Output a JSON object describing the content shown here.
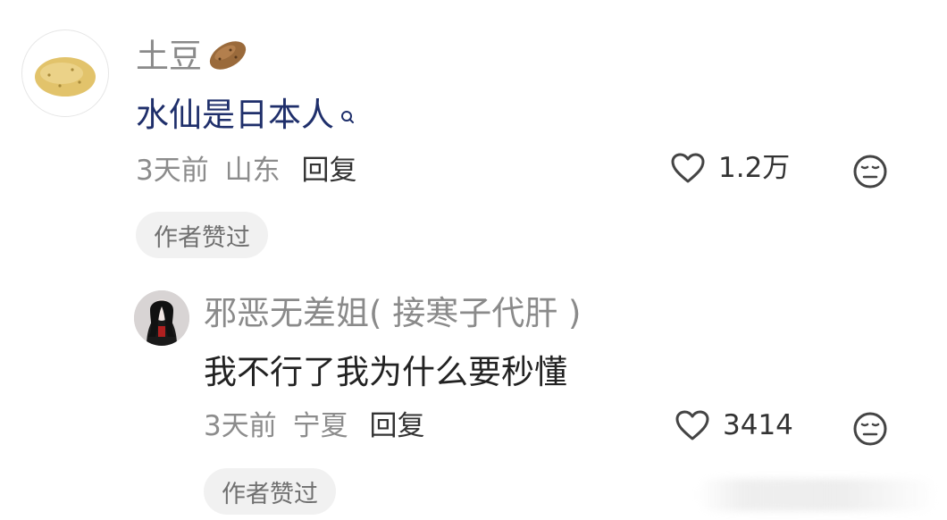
{
  "comment": {
    "username": "土豆",
    "username_icon": "potato-emoji",
    "text": "水仙是日本人",
    "search_icon": "search-icon",
    "time": "3天前",
    "location": "山东",
    "reply_label": "回复",
    "likes": "1.2万",
    "badge": "作者赞过"
  },
  "reply": {
    "username": "邪恶无差姐( 接寒子代肝 )",
    "text": "我不行了我为什么要秒懂",
    "time": "3天前",
    "location": "宁夏",
    "reply_label": "回复",
    "likes": "3414",
    "badge": "作者赞过"
  },
  "colors": {
    "highlight_text": "#1f2f6b",
    "muted": "#8c8c8c",
    "badge_bg": "#f1f1f1"
  }
}
